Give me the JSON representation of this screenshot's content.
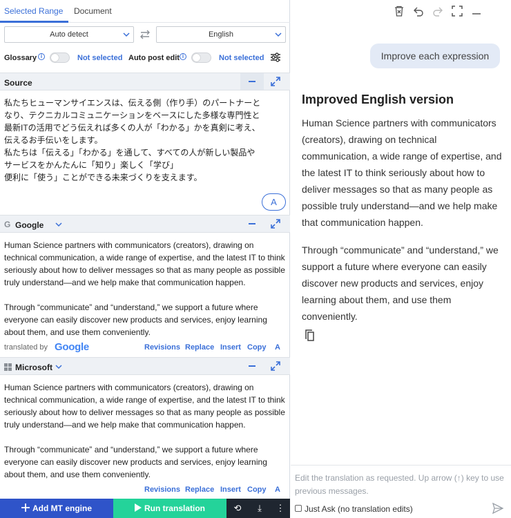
{
  "tabs": {
    "selected_range": "Selected Range",
    "document": "Document"
  },
  "lang": {
    "source": "Auto detect",
    "target": "English",
    "swap_icon": "swap-icon"
  },
  "options": {
    "glossary_label": "Glossary",
    "glossary_value": "Not selected",
    "auto_post_edit_label": "Auto post edit",
    "auto_post_edit_value": "Not selected",
    "info_glyph": "i"
  },
  "source": {
    "title": "Source",
    "lines": [
      "私たちヒューマンサイエンスは、伝える側（作り手）のパートナーと",
      "なり、テクニカルコミュニケーションをベースにした多様な専門性と",
      "最新ITの活用でどう伝えれば多くの人が「わかる」かを真剣に考え、",
      "伝えるお手伝いをします。",
      "私たちは「伝える」「わかる」を通して、すべての人が新しい製品や",
      "サービスをかんたんに「知り」楽しく「学び」",
      "便利に「使う」ことができる未来づくりを支えます。"
    ],
    "a_button": "A"
  },
  "google": {
    "title": "Google",
    "icon_glyph": "G",
    "para1": "Human Science partners with communicators (creators), drawing on technical communication, a wide range of expertise, and the latest IT to think seriously about how to deliver messages so that as many people as possible truly understand—and we help make that communication happen.",
    "para2": "Through “communicate” and “understand,” we support a future where everyone can easily discover new products and services, enjoy learning about them, and use them conveniently.",
    "translated_by": "translated by",
    "logo": "Google",
    "actions": [
      "Revisions",
      "Replace",
      "Insert",
      "Copy"
    ],
    "style_glyph": "A"
  },
  "microsoft": {
    "title": "Microsoft",
    "para1": "Human Science partners with communicators (creators), drawing on technical communication, a wide range of expertise, and the latest IT to think seriously about how to deliver messages so that as many people as possible truly understand—and we help make that communication happen.",
    "para2": "Through “communicate” and “understand,” we support a future where everyone can easily discover new products and services, enjoy learning about them, and use them conveniently.",
    "actions": [
      "Revisions",
      "Replace",
      "Insert",
      "Copy"
    ],
    "style_glyph": "A"
  },
  "bottom": {
    "add_label": "Add MT engine",
    "run_label": "Run translation",
    "history_glyph": "⟲",
    "download_glyph": "⤓",
    "more_glyph": "⋮"
  },
  "chat": {
    "user_message": "Improve each expression",
    "heading": "Improved English version",
    "para1": "Human Science partners with communicators (creators), drawing on technical communication, a wide range of expertise, and the latest IT to think seriously about how to deliver messages so that as many people as possible truly understand—and we help make that communication happen.",
    "para2": "Through “communicate” and “understand,” we support a future where everyone can easily discover new products and services, enjoy learning about them, and use them conveniently.",
    "input_placeholder": "Edit the translation as requested. Up arrow (↑) key to use previous messages.",
    "just_ask_label": "Just Ask (no translation edits)"
  },
  "colors": {
    "accent": "#3a6fd8",
    "add_btn": "#2f54c9",
    "run_btn": "#24d39a",
    "dark": "#1f2630"
  }
}
